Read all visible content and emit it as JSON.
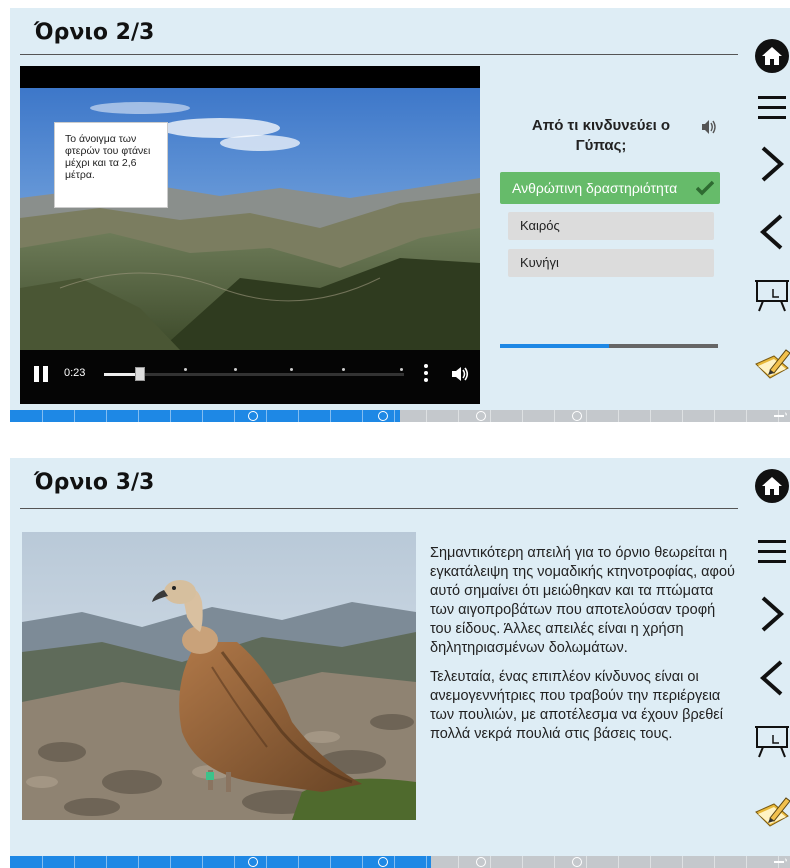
{
  "slide1": {
    "title": "Όρνιο 2/3",
    "video": {
      "tooltip": "Το άνοιγμα των φτερών του φτάνει μέχρι και τα 2,6 μέτρα.",
      "time": "0:23",
      "progress": 0.12
    },
    "quiz": {
      "question": "Από τι κινδυνεύει ο Γύπας;",
      "answers": [
        {
          "label": "Ανθρώπινη δραστηριότητα",
          "correct": true
        },
        {
          "label": "Καιρός",
          "correct": false
        },
        {
          "label": "Κυνήγι",
          "correct": false
        }
      ],
      "progress": 0.5
    },
    "course_progress": 0.5
  },
  "slide2": {
    "title": "Όρνιο 3/3",
    "paragraphs": [
      "Σημαντικότερη απειλή για το όρνιο θεωρείται η εγκατάλειψη της νομαδικής κτηνοτροφίας, αφού αυτό σημαίνει ότι μειώθηκαν και τα πτώματα των αιγοπροβάτων που αποτελούσαν τροφή του είδους. Άλλες απειλές είναι η χρήση δηλητηριασμένων δολωμάτων.",
      "Τελευταία, ένας επιπλέον κίνδυνος είναι οι ανεμογεννήτριες που τραβούν την περιέργεια των πουλιών, με αποτέλεσμα να έχουν βρεθεί πολλά νεκρά πουλιά στις βάσεις τους."
    ],
    "course_progress": 0.54
  },
  "sidebar_icons": [
    "home-icon",
    "menu-icon",
    "chevron-right-icon",
    "chevron-left-icon",
    "presentation-board-icon",
    "notebook-pencil-icon"
  ],
  "colors": {
    "accent": "#1e88e5",
    "panel": "#deedf5",
    "correct": "#66bb6a"
  }
}
